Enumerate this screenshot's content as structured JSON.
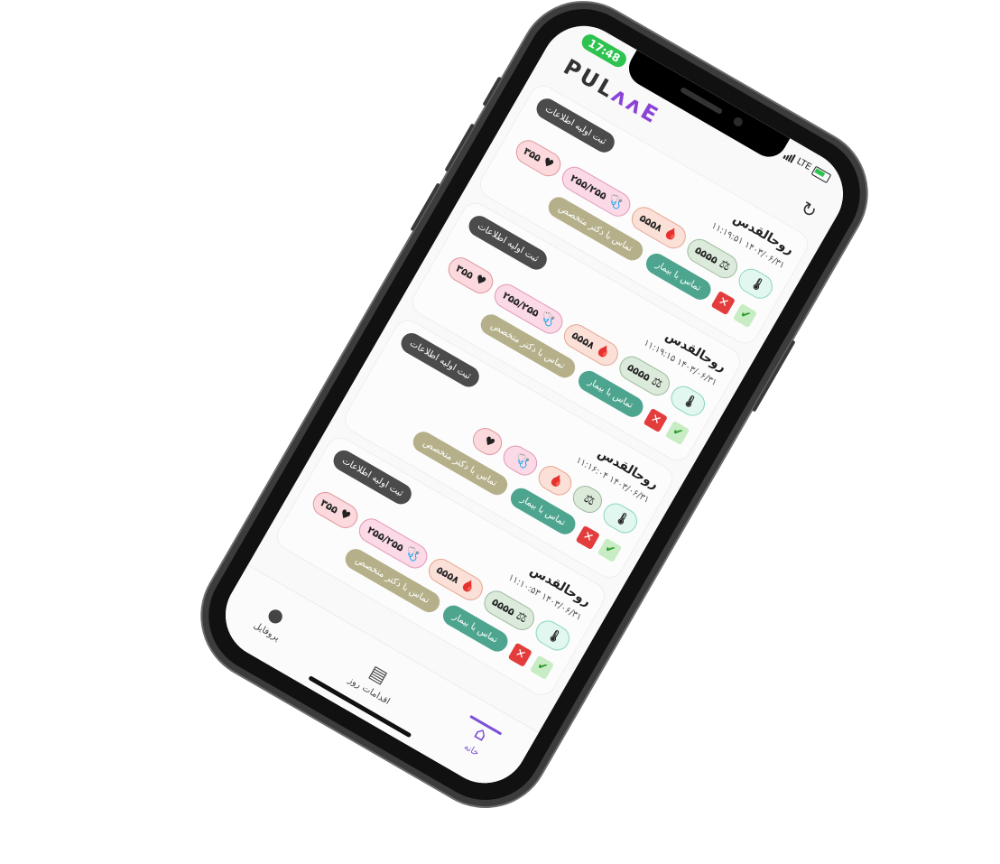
{
  "status": {
    "time": "17:48",
    "network": "LTE"
  },
  "header": {
    "logo_main": "PUL",
    "logo_accent": "ᴧᴧE",
    "refresh_icon": "refresh-icon"
  },
  "cards": [
    {
      "name": "روحالقدس",
      "datetime": "۱۴۰۳/۰۶/۳۱ ۱۱:۱۹:۵۱",
      "register_label": "ثبت اولیه اطلاعات",
      "vitals": {
        "temp": "",
        "weight": "۵۵۵۵",
        "sugar": "۵۵۵۸",
        "bp": "۲۵۵/۲۵۵",
        "hr": "۳۵۵"
      },
      "call_patient": "تماس با بیمار",
      "call_doctor": "تماس با دکتر متخصص"
    },
    {
      "name": "روحالقدس",
      "datetime": "۱۴۰۳/۰۶/۳۱ ۱۱:۱۹:۱۵",
      "register_label": "ثبت اولیه اطلاعات",
      "vitals": {
        "temp": "",
        "weight": "۵۵۵۵",
        "sugar": "۵۵۵۸",
        "bp": "۲۵۵/۲۵۵",
        "hr": "۳۵۵"
      },
      "call_patient": "تماس با بیمار",
      "call_doctor": "تماس با دکتر متخصص"
    },
    {
      "name": "روحالقدس",
      "datetime": "۱۴۰۳/۰۶/۳۱ ۱۱:۱۶:۰۴",
      "register_label": "ثبت اولیه اطلاعات",
      "vitals": {
        "temp": "",
        "weight": "",
        "sugar": "",
        "bp": "",
        "hr": ""
      },
      "call_patient": "تماس با بیمار",
      "call_doctor": "تماس با دکتر متخصص"
    },
    {
      "name": "روحالقدس",
      "datetime": "۱۴۰۳/۰۶/۳۱ ۱۱:۱۰:۵۳",
      "register_label": "ثبت اولیه اطلاعات",
      "vitals": {
        "temp": "",
        "weight": "۵۵۵۵",
        "sugar": "۵۵۵۸",
        "bp": "۲۵۵/۲۵۵",
        "hr": "۳۵۵"
      },
      "call_patient": "تماس با بیمار",
      "call_doctor": "تماس با دکتر متخصص"
    }
  ],
  "tabs": [
    {
      "label": "خانه",
      "icon": "home-icon",
      "active": true
    },
    {
      "label": "اقدامات روز",
      "icon": "document-icon",
      "active": false
    },
    {
      "label": "پروفایل",
      "icon": "profile-icon",
      "active": false
    }
  ],
  "colors": {
    "accent": "#7b4fd8",
    "status_green": "#2ec24f",
    "call_patient": "#4ea58f",
    "call_doctor": "#b5b08a",
    "reject": "#e33c3c"
  }
}
